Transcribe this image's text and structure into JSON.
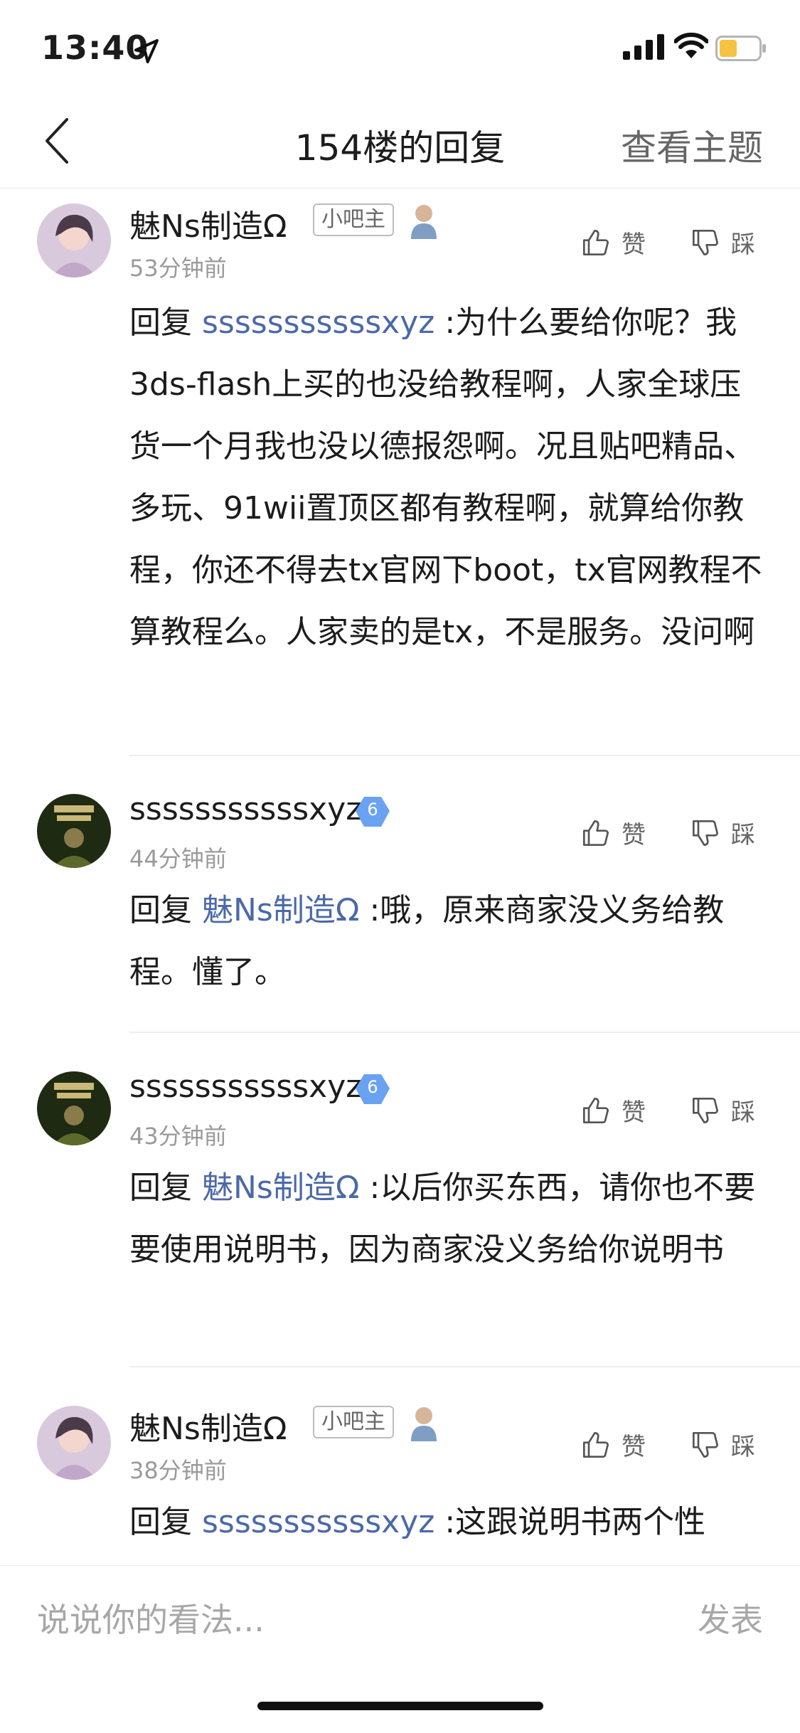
{
  "status_bar": {
    "time": "13:40"
  },
  "header": {
    "title": "154楼的回复",
    "action": "查看主题"
  },
  "replies": [
    {
      "username": "魅Ns制造Ω",
      "badge": "小吧主",
      "time": "53分钟前",
      "reply_prefix": "回复 ",
      "mention": "sssssssssssxyz",
      "text": " :为什么要给你呢？我3ds-flash上买的也没给教程啊，人家全球压货一个月我也没以德报怨啊。况且贴吧精品、多玩、91wii置顶区都有教程啊，就算给你教程，你还不得去tx官网下boot，tx官网教程不算教程么。人家卖的是tx，不是服务。没问啊",
      "like": "赞",
      "dislike": "踩"
    },
    {
      "username": "sssssssssssxyz",
      "level": "6",
      "time": "44分钟前",
      "reply_prefix": "回复 ",
      "mention": "魅Ns制造Ω",
      "text": " :哦，原来商家没义务给教程。懂了。",
      "like": "赞",
      "dislike": "踩"
    },
    {
      "username": "sssssssssssxyz",
      "level": "6",
      "time": "43分钟前",
      "reply_prefix": "回复 ",
      "mention": "魅Ns制造Ω",
      "text": " :以后你买东西，请你也不要要使用说明书，因为商家没义务给你说明书",
      "like": "赞",
      "dislike": "踩"
    },
    {
      "username": "魅Ns制造Ω",
      "badge": "小吧主",
      "time": "38分钟前",
      "reply_prefix": "回复 ",
      "mention": "sssssssssssxyz",
      "text": " :这跟说明书两个性",
      "like": "赞",
      "dislike": "踩"
    }
  ],
  "comment_bar": {
    "placeholder": "说说你的看法...",
    "post_label": "发表"
  },
  "colors": {
    "mention": "#4b69a8",
    "level_badge": "#6aa2f2",
    "battery": "#f5c242"
  },
  "icons": [
    "location-arrow-icon",
    "signal-icon",
    "wifi-icon",
    "battery-icon",
    "back-icon",
    "thumbs-up-icon",
    "thumbs-down-icon",
    "moderator-icon",
    "level-badge-icon"
  ]
}
